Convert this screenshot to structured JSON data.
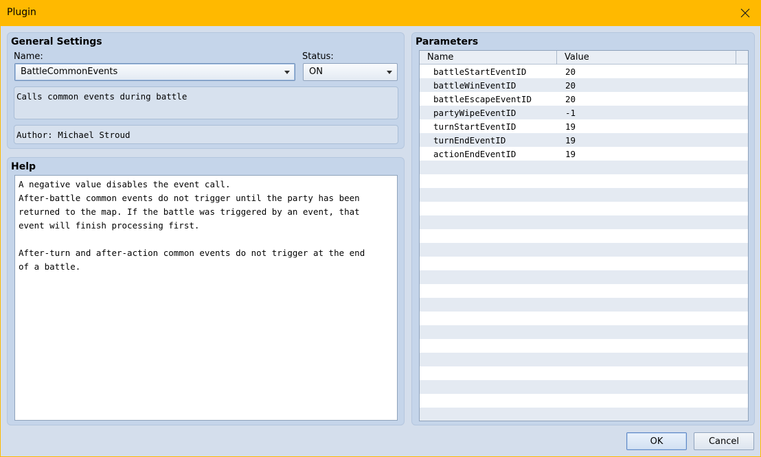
{
  "window": {
    "title": "Plugin"
  },
  "general": {
    "title": "General Settings",
    "name_label": "Name:",
    "name_value": "BattleCommonEvents",
    "status_label": "Status:",
    "status_value": "ON",
    "description": "Calls common events during battle",
    "author": "Author: Michael Stroud"
  },
  "help": {
    "title": "Help",
    "text": "A negative value disables the event call.\nAfter-battle common events do not trigger until the party has been\nreturned to the map. If the battle was triggered by an event, that\nevent will finish processing first.\n\nAfter-turn and after-action common events do not trigger at the end\nof a battle."
  },
  "parameters": {
    "title": "Parameters",
    "columns": [
      "Name",
      "Value"
    ],
    "rows": [
      {
        "name": "battleStartEventID",
        "value": "20"
      },
      {
        "name": "battleWinEventID",
        "value": "20"
      },
      {
        "name": "battleEscapeEventID",
        "value": "20"
      },
      {
        "name": "partyWipeEventID",
        "value": "-1"
      },
      {
        "name": "turnStartEventID",
        "value": "19"
      },
      {
        "name": "turnEndEventID",
        "value": "19"
      },
      {
        "name": "actionEndEventID",
        "value": "19"
      }
    ]
  },
  "buttons": {
    "ok": "OK",
    "cancel": "Cancel"
  }
}
